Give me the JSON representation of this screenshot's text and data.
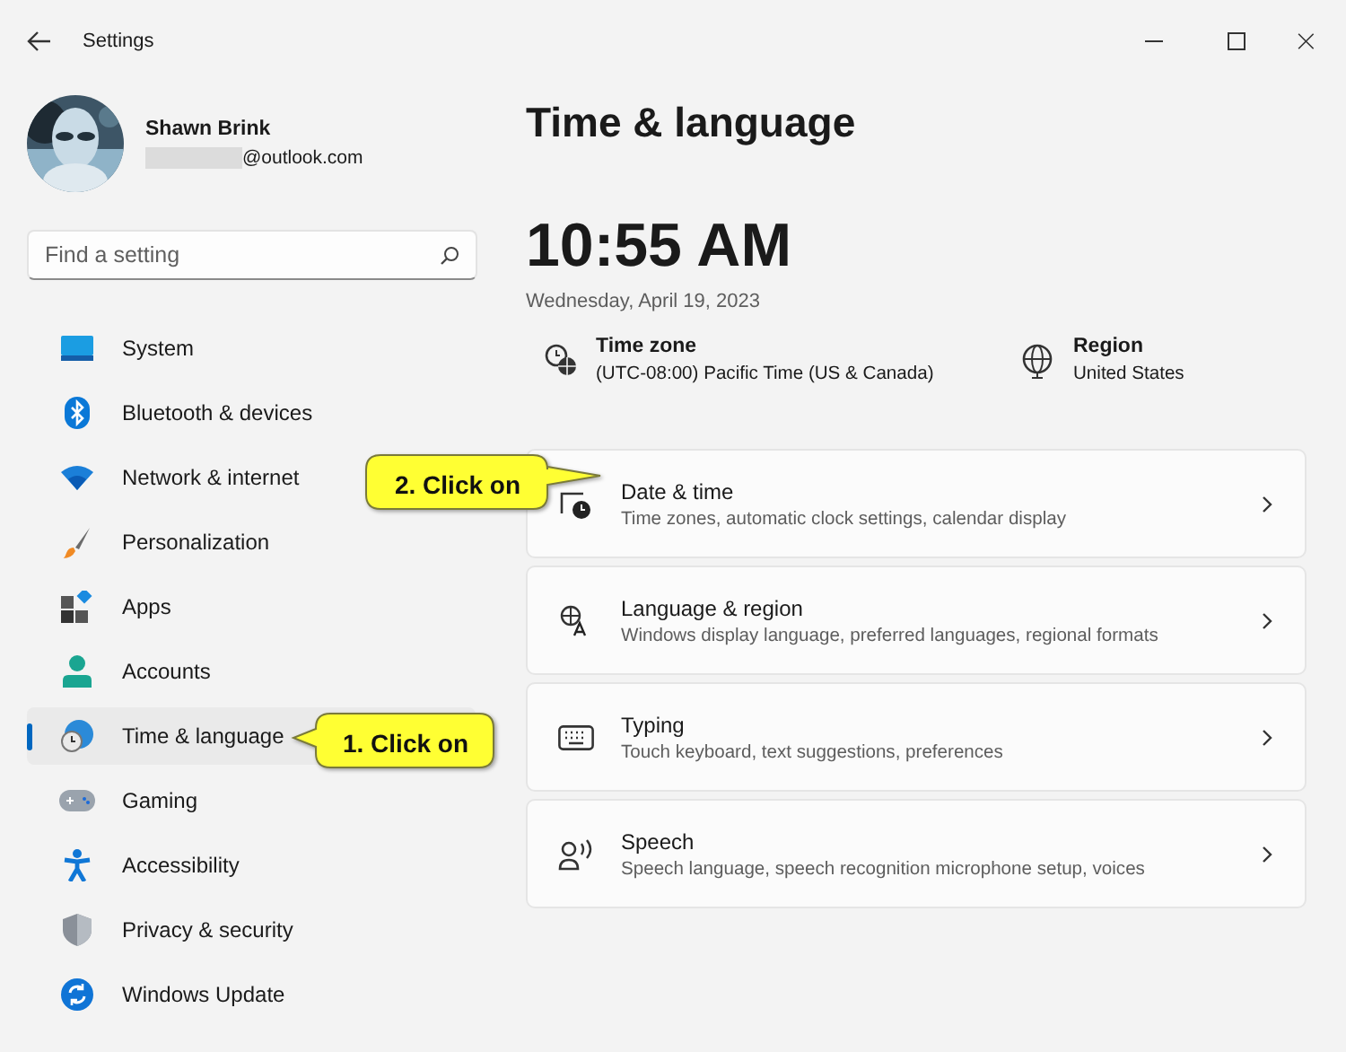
{
  "window": {
    "title": "Settings"
  },
  "profile": {
    "name": "Shawn Brink",
    "email": "@outlook.com"
  },
  "search": {
    "placeholder": "Find a setting"
  },
  "nav": [
    {
      "label": "System",
      "selected": false
    },
    {
      "label": "Bluetooth & devices",
      "selected": false
    },
    {
      "label": "Network & internet",
      "selected": false
    },
    {
      "label": "Personalization",
      "selected": false
    },
    {
      "label": "Apps",
      "selected": false
    },
    {
      "label": "Accounts",
      "selected": false
    },
    {
      "label": "Time & language",
      "selected": true
    },
    {
      "label": "Gaming",
      "selected": false
    },
    {
      "label": "Accessibility",
      "selected": false
    },
    {
      "label": "Privacy & security",
      "selected": false
    },
    {
      "label": "Windows Update",
      "selected": false
    }
  ],
  "page": {
    "title": "Time & language",
    "clock": "10:55 AM",
    "date": "Wednesday, April 19, 2023"
  },
  "info": [
    {
      "label": "Time zone",
      "value": "(UTC-08:00) Pacific Time (US & Canada)"
    },
    {
      "label": "Region",
      "value": "United States"
    }
  ],
  "cards": [
    {
      "title": "Date & time",
      "description": "Time zones, automatic clock settings, calendar display"
    },
    {
      "title": "Language & region",
      "description": "Windows display language, preferred languages, regional formats"
    },
    {
      "title": "Typing",
      "description": "Touch keyboard, text suggestions, preferences"
    },
    {
      "title": "Speech",
      "description": "Speech language, speech recognition microphone setup, voices"
    }
  ],
  "callouts": [
    {
      "text": "2. Click on"
    },
    {
      "text": "1. Click on"
    }
  ]
}
